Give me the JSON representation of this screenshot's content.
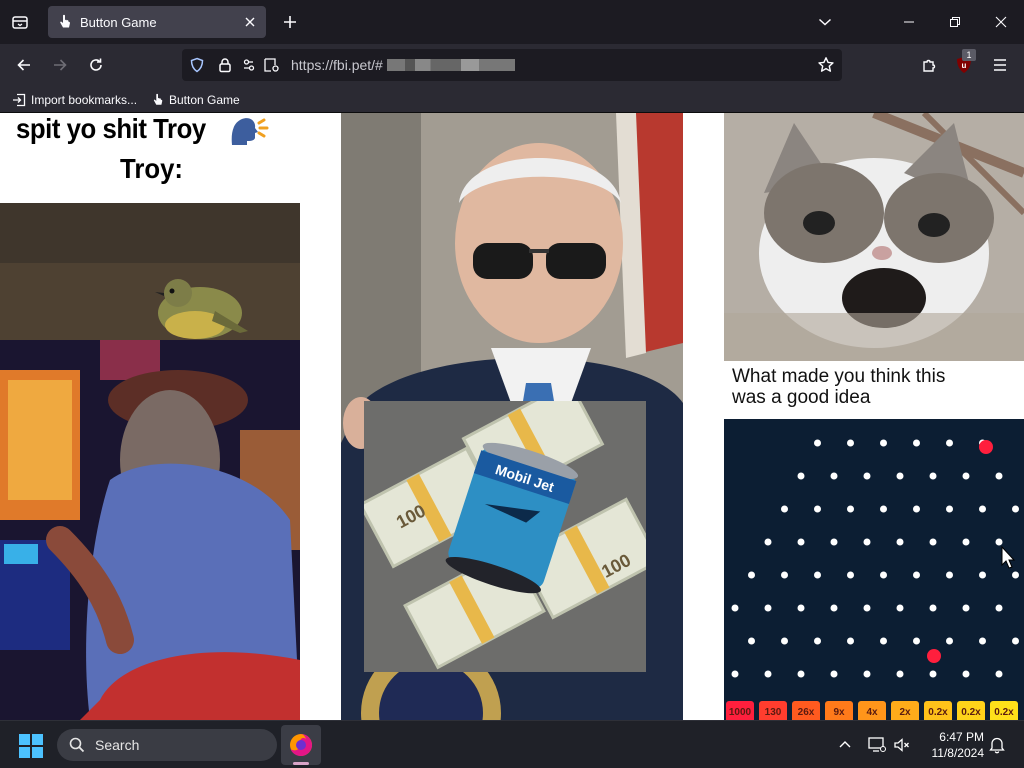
{
  "browser": {
    "tab": {
      "title": "Button Game"
    },
    "url": {
      "text": "https://fbi.pet/#"
    },
    "extension_badge": "1",
    "bookmarks": [
      {
        "label": "Import bookmarks..."
      },
      {
        "label": "Button Game"
      }
    ]
  },
  "page": {
    "meme_top": {
      "line1": "spit yo shit Troy",
      "line2": "Troy:"
    },
    "cat_caption": {
      "line1": "What made you think this",
      "line2": "was a good idea"
    },
    "money_can": {
      "brand": "Mobil Jet",
      "bill_value": "100"
    },
    "plinko": {
      "multipliers": [
        "1000",
        "130",
        "26x",
        "9x",
        "4x",
        "2x",
        "0.2x",
        "0.2x",
        "0.2x"
      ],
      "colors": [
        "#ff1f3d",
        "#ff3d2e",
        "#ff5a1f",
        "#ff7a1a",
        "#ff951a",
        "#ffac1a",
        "#ffc21a",
        "#ffd21a",
        "#ffe01a"
      ]
    }
  },
  "taskbar": {
    "search_placeholder": "Search",
    "time": "6:47 PM",
    "date": "11/8/2024"
  }
}
